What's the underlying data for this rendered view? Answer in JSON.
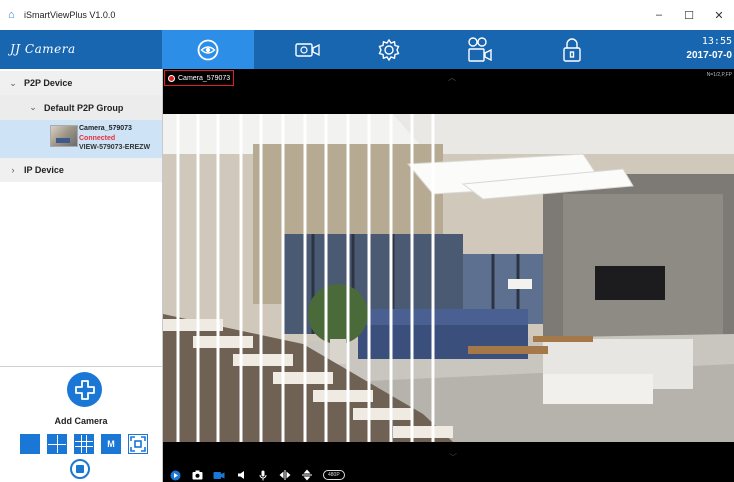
{
  "window": {
    "title": "iSmartViewPlus  V1.0.0",
    "minimize": "–",
    "maximize": "☐",
    "close": "✕"
  },
  "navbar": {
    "brand": "JJ Camera",
    "active_tab": "live-view",
    "tabs": [
      {
        "name": "live-view",
        "icon": "eye-icon"
      },
      {
        "name": "playback",
        "icon": "video-camera-icon"
      },
      {
        "name": "settings",
        "icon": "gear-icon"
      },
      {
        "name": "recording",
        "icon": "record-camera-icon"
      },
      {
        "name": "lock",
        "icon": "lock-icon"
      }
    ],
    "time": "13:55",
    "date": "2017-07-0"
  },
  "sidebar": {
    "p2p_device": "P2P Device",
    "default_group": "Default P2P Group",
    "camera": {
      "name": "Camera_579073",
      "status": "Connected",
      "uid": "VIEW-579073-EREZW"
    },
    "ip_device": "IP Device"
  },
  "controls": {
    "add_camera": "Add Camera",
    "multi_label": "M"
  },
  "video": {
    "camera_label": "Camera_579073",
    "stream_info": "N=1/2,P,FP",
    "resolution": "480P"
  },
  "colors": {
    "nav_bg": "#1865b0",
    "nav_active": "#2d8ee8",
    "accent": "#1a77d6",
    "status_connected": "#e8313a"
  }
}
